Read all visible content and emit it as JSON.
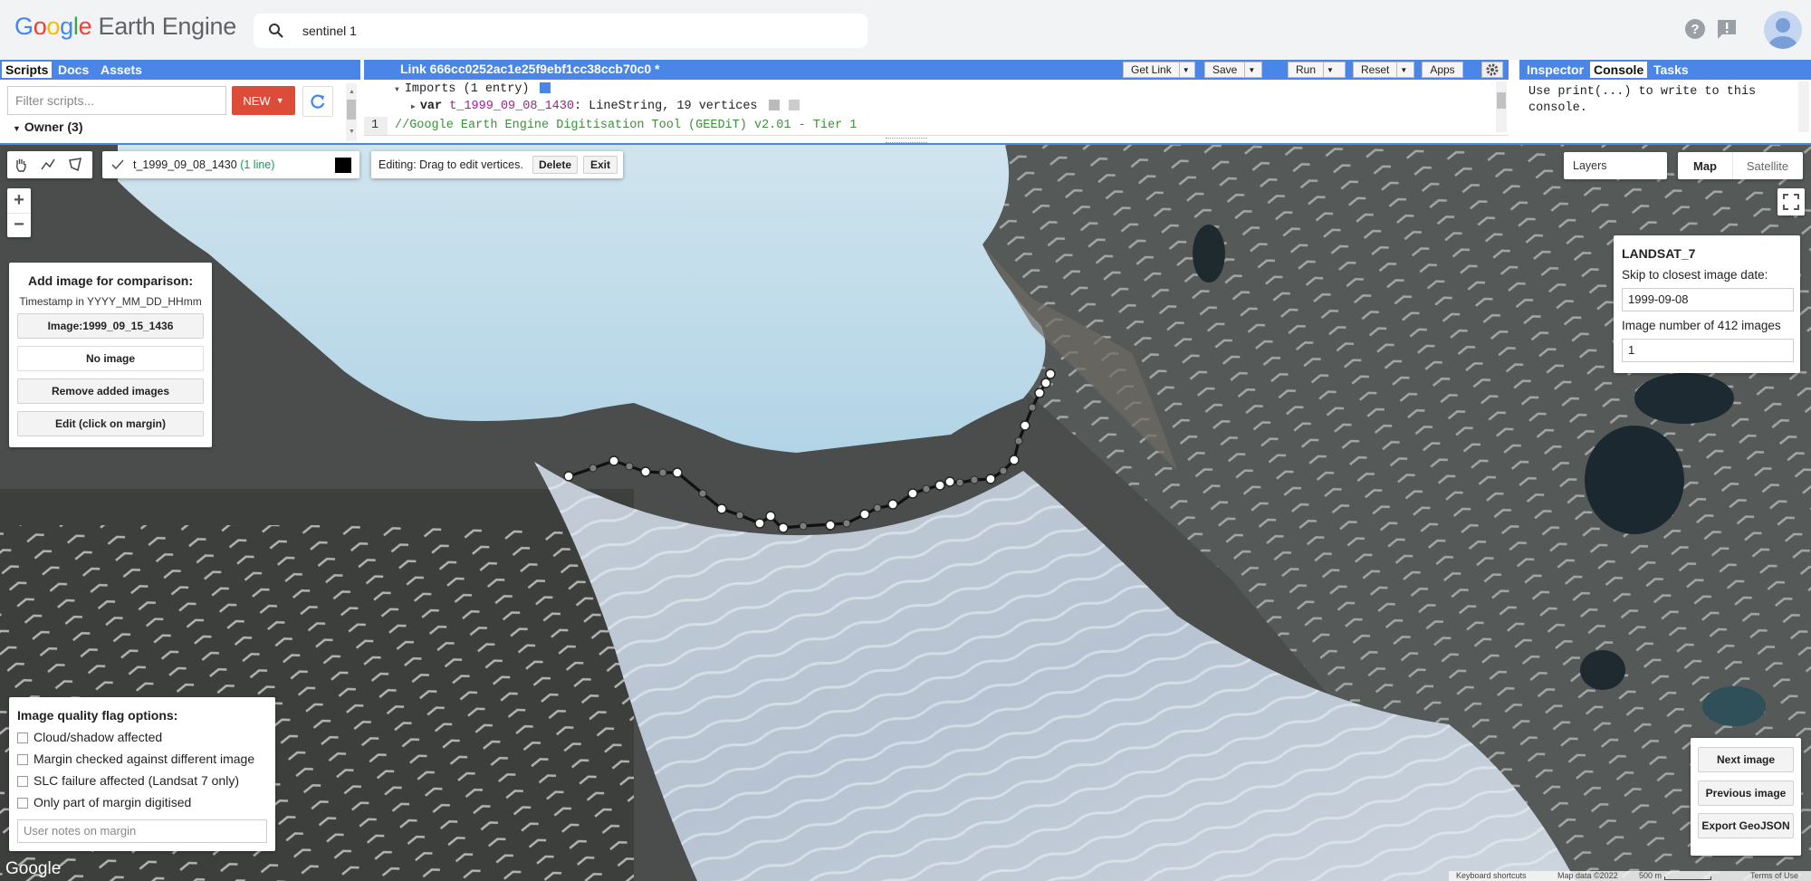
{
  "app": {
    "logo_google": "Google",
    "logo_product": "Earth Engine",
    "search_value": "sentinel 1"
  },
  "left_panel": {
    "tabs": [
      "Scripts",
      "Docs",
      "Assets"
    ],
    "filter_placeholder": "Filter scripts...",
    "new_label": "NEW",
    "owner_label": "Owner (3)"
  },
  "editor": {
    "title": "Link 666cc0252ac1e25f9ebf1cc38ccb70c0 *",
    "buttons": {
      "get_link": "Get Link",
      "save": "Save",
      "run": "Run",
      "reset": "Reset",
      "apps": "Apps"
    },
    "imports_line": "Imports (1 entry)",
    "var_keyword": "var",
    "var_name": "t_1999_09_08_1430",
    "var_type": ": LineString, 19 vertices",
    "line_number": "1",
    "code_line": "//Google Earth Engine Digitisation Tool (GEEDiT) v2.01 - Tier 1"
  },
  "right_panel": {
    "tabs": [
      "Inspector",
      "Console",
      "Tasks"
    ],
    "console_text": "Use print(...) to write to this console."
  },
  "map": {
    "layer_name": "t_1999_09_08_1430",
    "layer_count": "(1 line)",
    "editing_text": "Editing: Drag to edit vertices.",
    "delete_label": "Delete",
    "exit_label": "Exit",
    "layers_label": "Layers",
    "map_label": "Map",
    "satellite_label": "Satellite",
    "zoom_in": "+",
    "zoom_out": "−",
    "comparison": {
      "title": "Add image for comparison:",
      "subtitle": "Timestamp in YYYY_MM_DD_HHmm",
      "image_button": "Image:1999_09_15_1436",
      "no_image": "No image",
      "remove_button": "Remove added images",
      "edit_button": "Edit (click on margin)"
    },
    "landsat": {
      "title": "LANDSAT_7",
      "skip_label": "Skip to closest image date:",
      "date_value": "1999-09-08",
      "image_number_label": "Image number of 412 images",
      "image_number_value": "1"
    },
    "quality": {
      "title": "Image quality flag options:",
      "options": [
        "Cloud/shadow affected",
        "Margin checked against different image",
        "SLC failure affected (Landsat 7 only)",
        "Only part of margin digitised"
      ],
      "notes_placeholder": "User notes on margin"
    },
    "nav": {
      "next": "Next image",
      "previous": "Previous image",
      "export": "Export GeoJSON"
    },
    "footer": {
      "google": "Google",
      "shortcuts": "Keyboard shortcuts",
      "map_data": "Map data ©2022",
      "scale": "500 m",
      "terms": "Terms of Use"
    }
  },
  "colors": {
    "panel_blue": "#4a86e8",
    "new_red": "#dd4b39",
    "layer_count_green": "#0f9d58"
  }
}
